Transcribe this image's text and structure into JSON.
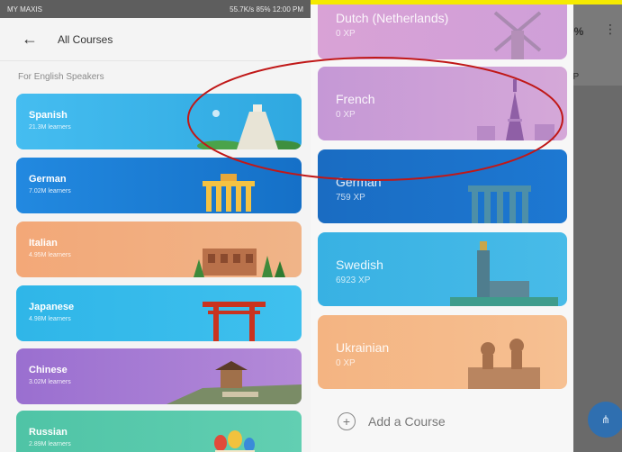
{
  "left": {
    "status_bar": {
      "carrier": "MY MAXIS",
      "right_info": "55.7K/s 85% 12:00 PM"
    },
    "app_bar": {
      "title": "All Courses"
    },
    "section_label": "For English Speakers",
    "courses": [
      {
        "name": "Spanish",
        "learners": "21.3M learners",
        "color": "#3fb5e8",
        "icon": "pyramid-icon"
      },
      {
        "name": "German",
        "learners": "7.02M learners",
        "color": "#1b7fd6",
        "icon": "brandenburg-gate-icon"
      },
      {
        "name": "Italian",
        "learners": "4.95M learners",
        "color": "#f2a97a",
        "icon": "colosseum-icon"
      },
      {
        "name": "Japanese",
        "learners": "4.98M learners",
        "color": "#2cb4e6",
        "icon": "torii-gate-icon"
      },
      {
        "name": "Chinese",
        "learners": "3.02M learners",
        "color": "#9c72d1",
        "icon": "great-wall-icon"
      },
      {
        "name": "Russian",
        "learners": "2.89M learners",
        "color": "#53c6a8",
        "icon": "onion-dome-icon"
      }
    ]
  },
  "right": {
    "backdrop": {
      "percent": "0%",
      "xp_fragment": "0P"
    },
    "courses": [
      {
        "name": "Dutch (Netherlands)",
        "xp": "0 XP",
        "color": "#d9a6d6",
        "icon": "windmill-icon"
      },
      {
        "name": "French",
        "xp": "0 XP",
        "color": "#c999d4",
        "icon": "eiffel-tower-icon"
      },
      {
        "name": "German",
        "xp": "759 XP",
        "color": "#1b6fc4",
        "icon": "brandenburg-gate-icon"
      },
      {
        "name": "Swedish",
        "xp": "6923 XP",
        "color": "#3bb3e4",
        "icon": "stockholm-city-hall-icon"
      },
      {
        "name": "Ukrainian",
        "xp": "0 XP",
        "color": "#f5b786",
        "icon": "monument-icon"
      }
    ],
    "add_course_label": "Add a Course"
  },
  "annotation_color": "#c01818"
}
